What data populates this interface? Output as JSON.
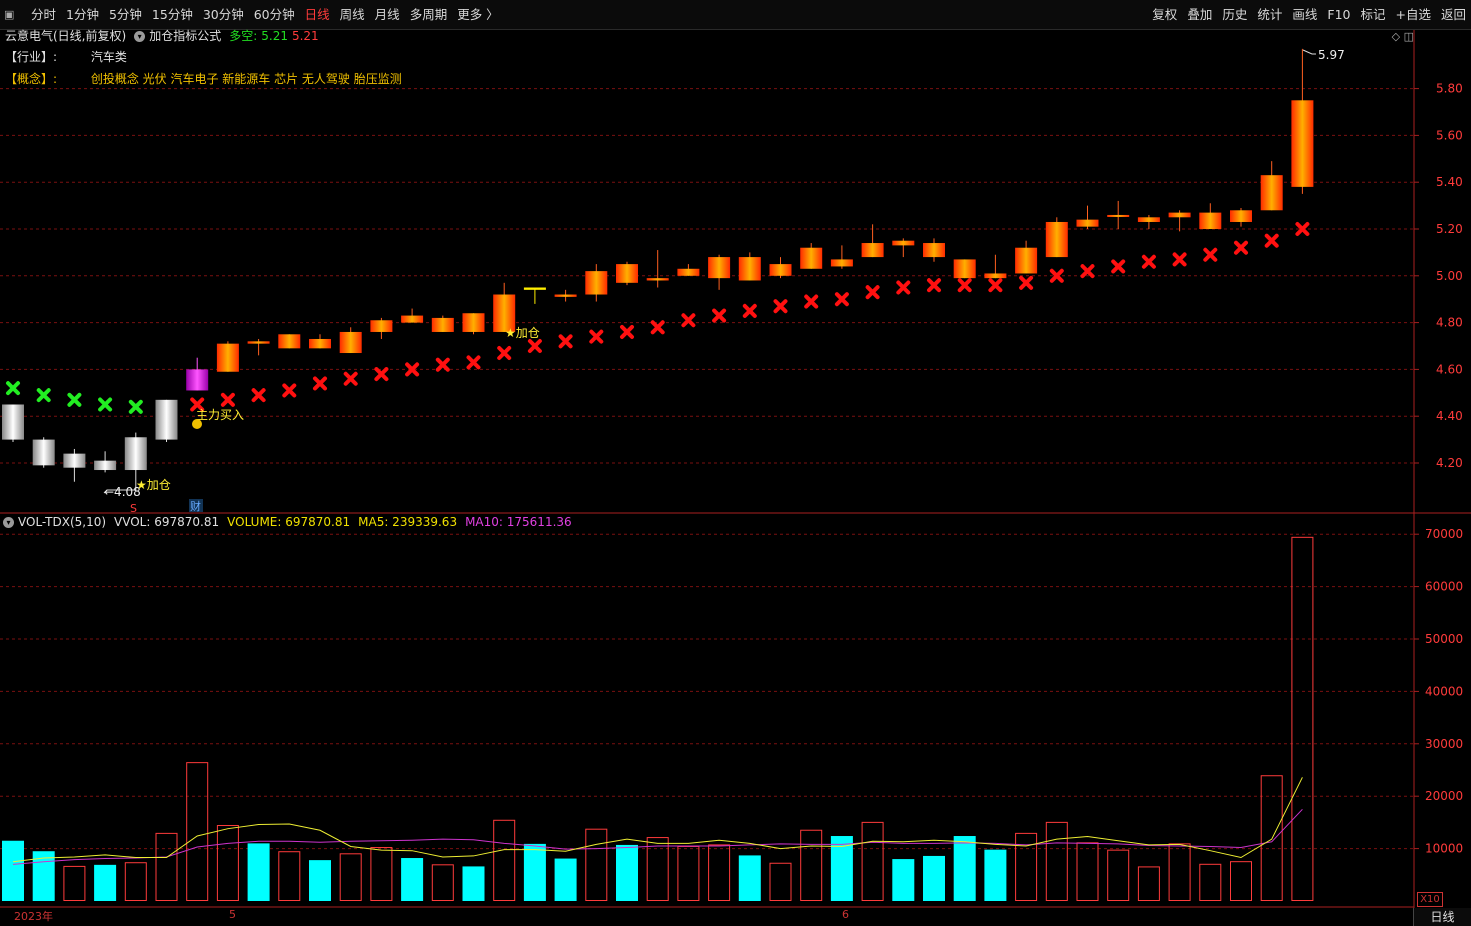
{
  "toolbar": {
    "periods": [
      "分时",
      "1分钟",
      "5分钟",
      "15分钟",
      "30分钟",
      "60分钟",
      "日线",
      "周线",
      "月线",
      "多周期",
      "更多 〉"
    ],
    "active_period": "日线",
    "right_buttons": [
      "复权",
      "叠加",
      "历史",
      "统计",
      "画线",
      "F10",
      "标记",
      "+自选",
      "返回"
    ]
  },
  "chart_header": {
    "stock": "云意电气(日线,前复权)",
    "formula": "加仓指标公式",
    "long_short_label": "多空:",
    "value1": "5.21",
    "value2": "5.21"
  },
  "info": {
    "industry_key": "【行业】:",
    "industry_val": "汽车类",
    "concept_key": "【概念】:",
    "concept_val": "创投概念 光伏 汽车电子 新能源车 芯片 无人驾驶 胎压监测"
  },
  "volume_header": {
    "name": "VOL-TDX(5,10)",
    "vvol": "VVOL: 697870.81",
    "volume": "VOLUME: 697870.81",
    "ma5": "MA5: 239339.63",
    "ma10": "MA10: 175611.36"
  },
  "annotations": {
    "high_label": "5.97",
    "low_label": "4.08",
    "add_label": "★加仓",
    "buy_label": "主力买入",
    "cai_label": "财",
    "s_label": "S"
  },
  "axis": {
    "date_labels": [
      "2023年",
      "5",
      "6"
    ],
    "x10_label": "X10",
    "period_label": "日线"
  },
  "colors": {
    "up": "#ff2a00",
    "up_grad_mid": "#ffb000",
    "down_cyan": "#00ffff",
    "down_silver": "#e8e8e8",
    "magenta": "#cc00cc",
    "green_x": "#22ee22",
    "red_x": "#ff1010",
    "grid": "#7a1010"
  },
  "chart_data": [
    {
      "type": "candlestick",
      "title": "云意电气(日线,前复权)",
      "yticks": [
        4.2,
        4.4,
        4.6,
        4.8,
        5.0,
        5.2,
        5.4,
        5.6,
        5.8
      ],
      "ylim": [
        4.0,
        6.0
      ],
      "candles": [
        {
          "o": 4.45,
          "h": 4.45,
          "l": 4.29,
          "c": 4.3,
          "color": "silver"
        },
        {
          "o": 4.3,
          "h": 4.31,
          "l": 4.18,
          "c": 4.19,
          "color": "silver"
        },
        {
          "o": 4.24,
          "h": 4.26,
          "l": 4.12,
          "c": 4.18,
          "color": "silver"
        },
        {
          "o": 4.21,
          "h": 4.25,
          "l": 4.16,
          "c": 4.17,
          "color": "silver"
        },
        {
          "o": 4.31,
          "h": 4.33,
          "l": 4.08,
          "c": 4.17,
          "color": "silver"
        },
        {
          "o": 4.47,
          "h": 4.47,
          "l": 4.29,
          "c": 4.3,
          "color": "silver"
        },
        {
          "o": 4.51,
          "h": 4.65,
          "l": 4.51,
          "c": 4.6,
          "color": "magenta"
        },
        {
          "o": 4.59,
          "h": 4.72,
          "l": 4.59,
          "c": 4.71,
          "color": "up"
        },
        {
          "o": 4.71,
          "h": 4.73,
          "l": 4.66,
          "c": 4.72,
          "color": "up"
        },
        {
          "o": 4.69,
          "h": 4.75,
          "l": 4.69,
          "c": 4.75,
          "color": "up"
        },
        {
          "o": 4.69,
          "h": 4.75,
          "l": 4.69,
          "c": 4.73,
          "color": "up"
        },
        {
          "o": 4.67,
          "h": 4.78,
          "l": 4.67,
          "c": 4.76,
          "color": "up"
        },
        {
          "o": 4.76,
          "h": 4.82,
          "l": 4.73,
          "c": 4.81,
          "color": "up"
        },
        {
          "o": 4.8,
          "h": 4.86,
          "l": 4.8,
          "c": 4.83,
          "color": "up"
        },
        {
          "o": 4.76,
          "h": 4.83,
          "l": 4.76,
          "c": 4.82,
          "color": "up"
        },
        {
          "o": 4.76,
          "h": 4.84,
          "l": 4.75,
          "c": 4.84,
          "color": "up"
        },
        {
          "o": 4.76,
          "h": 4.97,
          "l": 4.76,
          "c": 4.92,
          "color": "up"
        },
        {
          "o": 4.94,
          "h": 4.95,
          "l": 4.88,
          "c": 4.95,
          "color": "yellow"
        },
        {
          "o": 4.91,
          "h": 4.94,
          "l": 4.89,
          "c": 4.92,
          "color": "up"
        },
        {
          "o": 4.92,
          "h": 5.05,
          "l": 4.89,
          "c": 5.02,
          "color": "up"
        },
        {
          "o": 4.97,
          "h": 5.06,
          "l": 4.96,
          "c": 5.05,
          "color": "up"
        },
        {
          "o": 4.98,
          "h": 5.11,
          "l": 4.95,
          "c": 4.99,
          "color": "up"
        },
        {
          "o": 5.0,
          "h": 5.05,
          "l": 5.0,
          "c": 5.03,
          "color": "up"
        },
        {
          "o": 4.99,
          "h": 5.09,
          "l": 4.94,
          "c": 5.08,
          "color": "up"
        },
        {
          "o": 4.98,
          "h": 5.1,
          "l": 4.98,
          "c": 5.08,
          "color": "up"
        },
        {
          "o": 5.0,
          "h": 5.08,
          "l": 4.99,
          "c": 5.05,
          "color": "up"
        },
        {
          "o": 5.03,
          "h": 5.14,
          "l": 5.03,
          "c": 5.12,
          "color": "up"
        },
        {
          "o": 5.04,
          "h": 5.13,
          "l": 5.03,
          "c": 5.07,
          "color": "up"
        },
        {
          "o": 5.08,
          "h": 5.22,
          "l": 5.08,
          "c": 5.14,
          "color": "up"
        },
        {
          "o": 5.13,
          "h": 5.16,
          "l": 5.08,
          "c": 5.15,
          "color": "up"
        },
        {
          "o": 5.08,
          "h": 5.16,
          "l": 5.06,
          "c": 5.14,
          "color": "up"
        },
        {
          "o": 4.99,
          "h": 5.07,
          "l": 4.99,
          "c": 5.07,
          "color": "up"
        },
        {
          "o": 4.99,
          "h": 5.09,
          "l": 4.99,
          "c": 5.01,
          "color": "up"
        },
        {
          "o": 5.01,
          "h": 5.15,
          "l": 5.01,
          "c": 5.12,
          "color": "up"
        },
        {
          "o": 5.08,
          "h": 5.25,
          "l": 5.08,
          "c": 5.23,
          "color": "up"
        },
        {
          "o": 5.21,
          "h": 5.3,
          "l": 5.2,
          "c": 5.24,
          "color": "up"
        },
        {
          "o": 5.26,
          "h": 5.32,
          "l": 5.2,
          "c": 5.26,
          "color": "up"
        },
        {
          "o": 5.23,
          "h": 5.26,
          "l": 5.2,
          "c": 5.25,
          "color": "up"
        },
        {
          "o": 5.25,
          "h": 5.28,
          "l": 5.19,
          "c": 5.27,
          "color": "up"
        },
        {
          "o": 5.2,
          "h": 5.31,
          "l": 5.2,
          "c": 5.27,
          "color": "up"
        },
        {
          "o": 5.23,
          "h": 5.29,
          "l": 5.21,
          "c": 5.28,
          "color": "up"
        },
        {
          "o": 5.28,
          "h": 5.49,
          "l": 5.28,
          "c": 5.43,
          "color": "up"
        },
        {
          "o": 5.38,
          "h": 5.97,
          "l": 5.35,
          "c": 5.75,
          "color": "up"
        }
      ],
      "signal_dots": [
        {
          "i": 0,
          "y": 4.52,
          "kind": "green"
        },
        {
          "i": 1,
          "y": 4.49,
          "kind": "green"
        },
        {
          "i": 2,
          "y": 4.47,
          "kind": "green"
        },
        {
          "i": 3,
          "y": 4.45,
          "kind": "green"
        },
        {
          "i": 4,
          "y": 4.44,
          "kind": "green"
        },
        {
          "i": 6,
          "y": 4.45,
          "kind": "red"
        },
        {
          "i": 7,
          "y": 4.47,
          "kind": "red"
        },
        {
          "i": 8,
          "y": 4.49,
          "kind": "red"
        },
        {
          "i": 9,
          "y": 4.51,
          "kind": "red"
        },
        {
          "i": 10,
          "y": 4.54,
          "kind": "red"
        },
        {
          "i": 11,
          "y": 4.56,
          "kind": "red"
        },
        {
          "i": 12,
          "y": 4.58,
          "kind": "red"
        },
        {
          "i": 13,
          "y": 4.6,
          "kind": "red"
        },
        {
          "i": 14,
          "y": 4.62,
          "kind": "red"
        },
        {
          "i": 15,
          "y": 4.63,
          "kind": "red"
        },
        {
          "i": 16,
          "y": 4.67,
          "kind": "red"
        },
        {
          "i": 17,
          "y": 4.7,
          "kind": "red"
        },
        {
          "i": 18,
          "y": 4.72,
          "kind": "red"
        },
        {
          "i": 19,
          "y": 4.74,
          "kind": "red"
        },
        {
          "i": 20,
          "y": 4.76,
          "kind": "red"
        },
        {
          "i": 21,
          "y": 4.78,
          "kind": "red"
        },
        {
          "i": 22,
          "y": 4.81,
          "kind": "red"
        },
        {
          "i": 23,
          "y": 4.83,
          "kind": "red"
        },
        {
          "i": 24,
          "y": 4.85,
          "kind": "red"
        },
        {
          "i": 25,
          "y": 4.87,
          "kind": "red"
        },
        {
          "i": 26,
          "y": 4.89,
          "kind": "red"
        },
        {
          "i": 27,
          "y": 4.9,
          "kind": "red"
        },
        {
          "i": 28,
          "y": 4.93,
          "kind": "red"
        },
        {
          "i": 29,
          "y": 4.95,
          "kind": "red"
        },
        {
          "i": 30,
          "y": 4.96,
          "kind": "red"
        },
        {
          "i": 31,
          "y": 4.96,
          "kind": "red"
        },
        {
          "i": 32,
          "y": 4.96,
          "kind": "red"
        },
        {
          "i": 33,
          "y": 4.97,
          "kind": "red"
        },
        {
          "i": 34,
          "y": 5.0,
          "kind": "red"
        },
        {
          "i": 35,
          "y": 5.02,
          "kind": "red"
        },
        {
          "i": 36,
          "y": 5.04,
          "kind": "red"
        },
        {
          "i": 37,
          "y": 5.06,
          "kind": "red"
        },
        {
          "i": 38,
          "y": 5.07,
          "kind": "red"
        },
        {
          "i": 39,
          "y": 5.09,
          "kind": "red"
        },
        {
          "i": 40,
          "y": 5.12,
          "kind": "red"
        },
        {
          "i": 41,
          "y": 5.15,
          "kind": "red"
        },
        {
          "i": 42,
          "y": 5.2,
          "kind": "red"
        }
      ]
    },
    {
      "type": "bar",
      "title": "VOL-TDX(5,10)",
      "yticks": [
        10000,
        20000,
        30000,
        40000,
        50000,
        60000,
        70000
      ],
      "ylim": [
        0,
        72000
      ],
      "volumes": [
        11500,
        9500,
        6700,
        6900,
        7400,
        13000,
        26500,
        14500,
        11000,
        9500,
        7800,
        9100,
        10300,
        8200,
        7000,
        6600,
        15500,
        10900,
        8100,
        13800,
        10700,
        12200,
        10500,
        10800,
        8700,
        7300,
        13600,
        12400,
        15100,
        8000,
        8600,
        12400,
        9800,
        13000,
        15100,
        11200,
        9800,
        6600,
        11000,
        7100,
        7600,
        24000,
        69500
      ],
      "bar_styles": [
        "cyan",
        "cyan",
        "hollow",
        "cyan",
        "hollow",
        "hollow",
        "hollow",
        "hollow",
        "cyan",
        "hollow",
        "cyan",
        "hollow",
        "hollow",
        "cyan",
        "hollow",
        "cyan",
        "hollow",
        "cyan",
        "cyan",
        "hollow",
        "cyan",
        "hollow",
        "hollow",
        "hollow",
        "cyan",
        "hollow",
        "hollow",
        "cyan",
        "hollow",
        "cyan",
        "cyan",
        "cyan",
        "cyan",
        "hollow",
        "hollow",
        "hollow",
        "hollow",
        "hollow",
        "hollow",
        "hollow",
        "hollow",
        "hollow",
        "hollow"
      ],
      "ma5": [
        7500,
        8200,
        8400,
        8800,
        8300,
        8300,
        12400,
        13800,
        14600,
        14700,
        13500,
        10400,
        9700,
        9600,
        8400,
        8600,
        9800,
        9800,
        9500,
        10800,
        11800,
        11000,
        11000,
        11600,
        11000,
        10000,
        10500,
        10400,
        11400,
        11300,
        11600,
        11300,
        10800,
        10500,
        11800,
        12300,
        11500,
        10700,
        10800,
        9600,
        8300,
        11800,
        23600
      ],
      "ma10": [
        7000,
        7500,
        7900,
        8100,
        8200,
        8400,
        10300,
        11000,
        11400,
        11400,
        11200,
        11400,
        11500,
        11600,
        11800,
        11700,
        11000,
        10500,
        9900,
        10000,
        10200,
        10500,
        10500,
        10500,
        10700,
        10900,
        10800,
        10800,
        11200,
        11000,
        11000,
        11100,
        11000,
        10700,
        11100,
        11000,
        10900,
        10600,
        10500,
        10400,
        10200,
        11300,
        17500
      ]
    }
  ]
}
